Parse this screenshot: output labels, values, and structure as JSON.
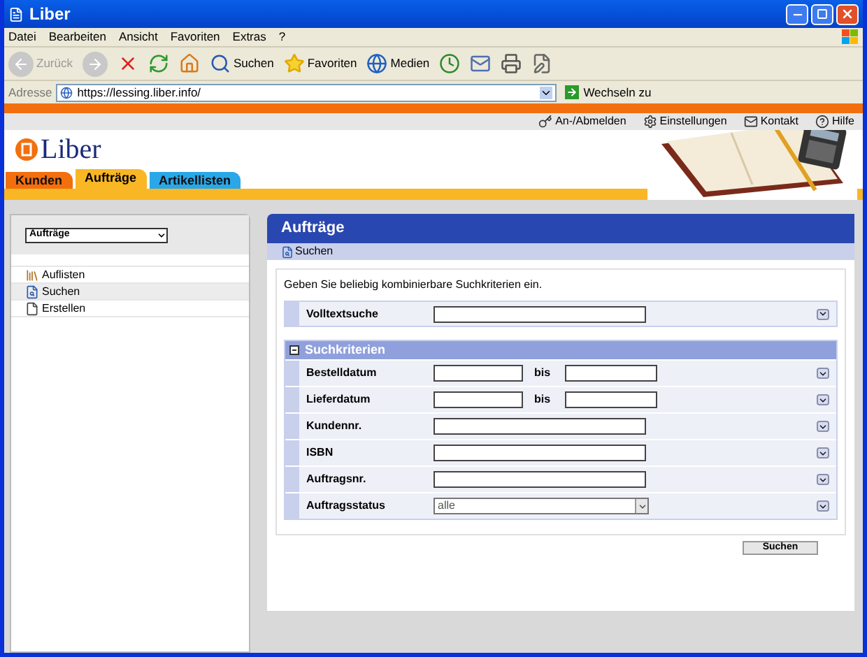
{
  "window": {
    "title": "Liber"
  },
  "menu": [
    "Datei",
    "Bearbeiten",
    "Ansicht",
    "Favoriten",
    "Extras",
    "?"
  ],
  "toolbar": [
    {
      "kind": "back",
      "label": "Zurück",
      "disabled": true
    },
    {
      "kind": "forward",
      "disabled": true
    },
    {
      "kind": "stop",
      "disabled": false
    },
    {
      "kind": "refresh",
      "disabled": false
    },
    {
      "kind": "home",
      "disabled": false
    },
    {
      "kind": "search",
      "label": "Suchen",
      "disabled": false
    },
    {
      "kind": "favorites",
      "label": "Favoriten",
      "disabled": false
    },
    {
      "kind": "media",
      "label": "Medien",
      "disabled": false
    },
    {
      "kind": "history",
      "disabled": false
    },
    {
      "kind": "mail",
      "disabled": false
    },
    {
      "kind": "print",
      "disabled": false
    },
    {
      "kind": "edit",
      "disabled": false
    }
  ],
  "address_bar": {
    "label": "Adresse",
    "value": "https://lessing.liber.info/",
    "go": "Wechseln zu"
  },
  "site": {
    "top_links": [
      {
        "kind": "key",
        "label": "An-/Abmelden"
      },
      {
        "kind": "settings",
        "label": "Einstellungen"
      },
      {
        "kind": "contact",
        "label": "Kontakt"
      },
      {
        "kind": "help",
        "label": "Hilfe"
      }
    ],
    "logo": "Liber",
    "tabs": [
      {
        "label": "Kunden",
        "selected": false,
        "color": "#f36f0e"
      },
      {
        "label": "Aufträge",
        "selected": true,
        "color": "#f9b625"
      },
      {
        "label": "Artikellisten",
        "selected": false,
        "color": "#2aa7e8"
      }
    ]
  },
  "sidebar": {
    "select": "Aufträge",
    "items": [
      {
        "kind": "list",
        "label": "Auflisten",
        "selected": false
      },
      {
        "kind": "search",
        "label": "Suchen",
        "selected": true
      },
      {
        "kind": "new",
        "label": "Erstellen",
        "selected": false
      }
    ]
  },
  "main": {
    "title": "Aufträge",
    "action": "Suchen",
    "intro": "Geben Sie beliebig kombinierbare Suchkriterien ein.",
    "fulltext": {
      "label": "Volltextsuche"
    },
    "criteria": {
      "title": "Suchkriterien",
      "expanded": true,
      "rows": [
        {
          "kind": "range",
          "label": "Bestelldatum",
          "separator": "bis"
        },
        {
          "kind": "range",
          "label": "Lieferdatum",
          "separator": "bis"
        },
        {
          "kind": "text",
          "label": "Kundennr."
        },
        {
          "kind": "text",
          "label": "ISBN"
        },
        {
          "kind": "text",
          "label": "Auftragsnr."
        },
        {
          "kind": "select",
          "label": "Auftragsstatus",
          "value": "alle"
        }
      ]
    },
    "submit": "Suchen"
  }
}
